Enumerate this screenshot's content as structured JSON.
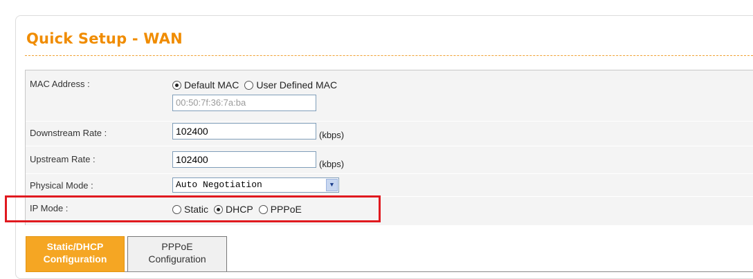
{
  "page": {
    "title": "Quick Setup - WAN"
  },
  "mac": {
    "label": "MAC Address :",
    "option_default": "Default MAC",
    "option_user": "User Defined MAC",
    "selected": "Default MAC",
    "value": "00:50:7f:36:7a:ba"
  },
  "downstream": {
    "label": "Downstream Rate :",
    "value": "102400",
    "unit": "(kbps)"
  },
  "upstream": {
    "label": "Upstream Rate :",
    "value": "102400",
    "unit": "(kbps)"
  },
  "physical": {
    "label": "Physical Mode :",
    "value": "Auto Negotiation"
  },
  "ipmode": {
    "label": "IP Mode :",
    "option_static": "Static",
    "option_dhcp": "DHCP",
    "option_pppoe": "PPPoE",
    "selected": "DHCP"
  },
  "tabs": {
    "static_dhcp_line1": "Static/DHCP",
    "static_dhcp_line2": "Configuration",
    "pppoe_line1": "PPPoE",
    "pppoe_line2": "Configuration"
  },
  "colors": {
    "accent": "#f08c00",
    "tab_active": "#f5a623",
    "highlight_box": "#e0191f"
  }
}
